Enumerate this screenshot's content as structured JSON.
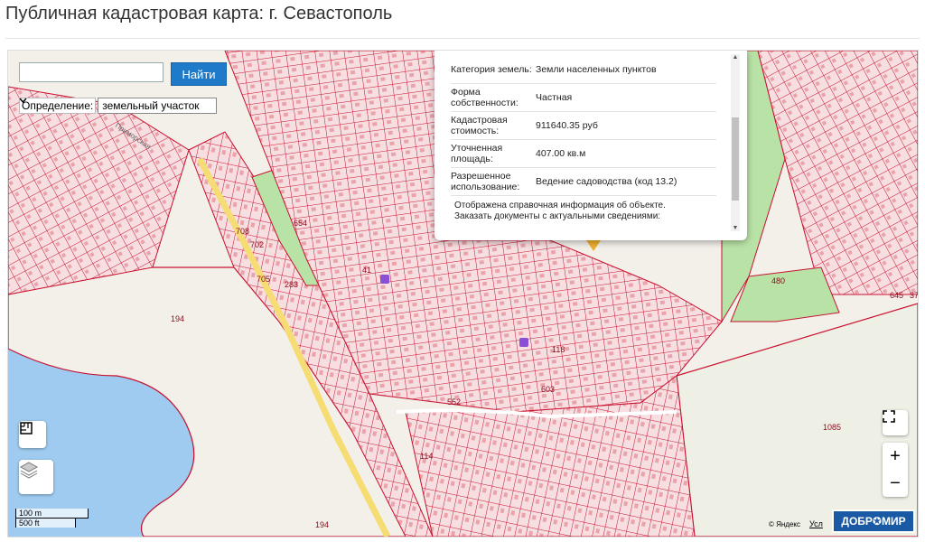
{
  "page": {
    "title": "Публичная кадастровая карта: г. Севастополь"
  },
  "search": {
    "value": "",
    "button_label": "Найти"
  },
  "definition": {
    "label": "Определение:",
    "selected": "земельный участок"
  },
  "popup": {
    "rows": [
      {
        "key": "Категория земель:",
        "value": "Земли населенных пунктов"
      },
      {
        "key": "Форма собственности:",
        "value": "Частная"
      },
      {
        "key": "Кадастровая стоимость:",
        "value": "911640.35 руб"
      },
      {
        "key": "Уточненная площадь:",
        "value": "407.00 кв.м"
      },
      {
        "key": "Разрешенное использование:",
        "value": "Ведение садоводства (код 13.2)"
      }
    ],
    "note": "Отображена справочная информация об объекте. Заказать документы с актуальными сведениями:"
  },
  "map": {
    "parcel_labels": [
      "194",
      "194",
      "654",
      "1085",
      "480",
      "702",
      "708",
      "705",
      "283",
      "41",
      "552",
      "603",
      "645",
      "37",
      "114",
      "118"
    ],
    "street_label": "Приморская"
  },
  "controls": {
    "zoom_in": "+",
    "zoom_out": "−"
  },
  "scale": {
    "metric": "100 m",
    "imperial": "500 ft"
  },
  "attribution": {
    "yandex": "© Яндекс",
    "terms": "Усл",
    "logo": "ДОБР✪МИР"
  },
  "colors": {
    "parcel_line": "#c8102e",
    "parcel_fill": "#f7dadd",
    "green": "#b9e3a6",
    "sea": "#9fcbf0",
    "button": "#1f7bc9"
  }
}
